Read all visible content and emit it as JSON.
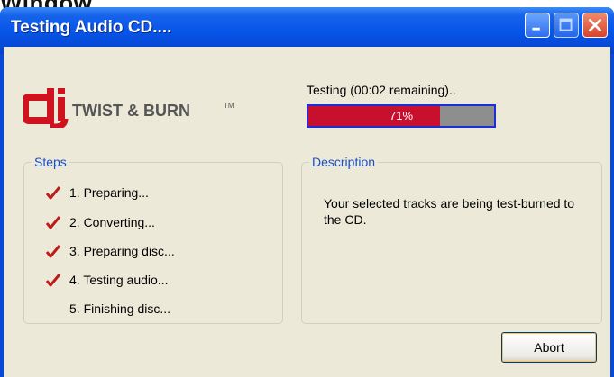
{
  "caption": "Window",
  "window": {
    "title": "Testing Audio CD....",
    "colors": {
      "titlebar": "#0654e8",
      "close_button": "#d9432a",
      "client_bg": "#ece9d8"
    }
  },
  "logo": {
    "text": "TWIST & BURN",
    "trademark": "TM",
    "brand_mark": "dj",
    "colors": {
      "mark": "#d0121f",
      "text": "#555555"
    }
  },
  "status": {
    "label": "Testing (00:02 remaining)..",
    "progress_percent": 71,
    "progress_label": "71%",
    "colors": {
      "fill": "#c8102e",
      "track": "#8e8e8e",
      "border": "#1b2fd6"
    }
  },
  "steps": {
    "title": "Steps",
    "items": [
      {
        "label": "1. Preparing...",
        "done": true
      },
      {
        "label": "2. Converting...",
        "done": true
      },
      {
        "label": "3. Preparing disc...",
        "done": true
      },
      {
        "label": "4. Testing audio...",
        "done": true
      },
      {
        "label": "5. Finishing disc...",
        "done": false
      }
    ],
    "check_icon": "check-mark-icon",
    "check_color": "#c01a1a"
  },
  "description": {
    "title": "Description",
    "text": "Your selected tracks are being test-burned to the CD."
  },
  "buttons": {
    "abort": "Abort"
  }
}
